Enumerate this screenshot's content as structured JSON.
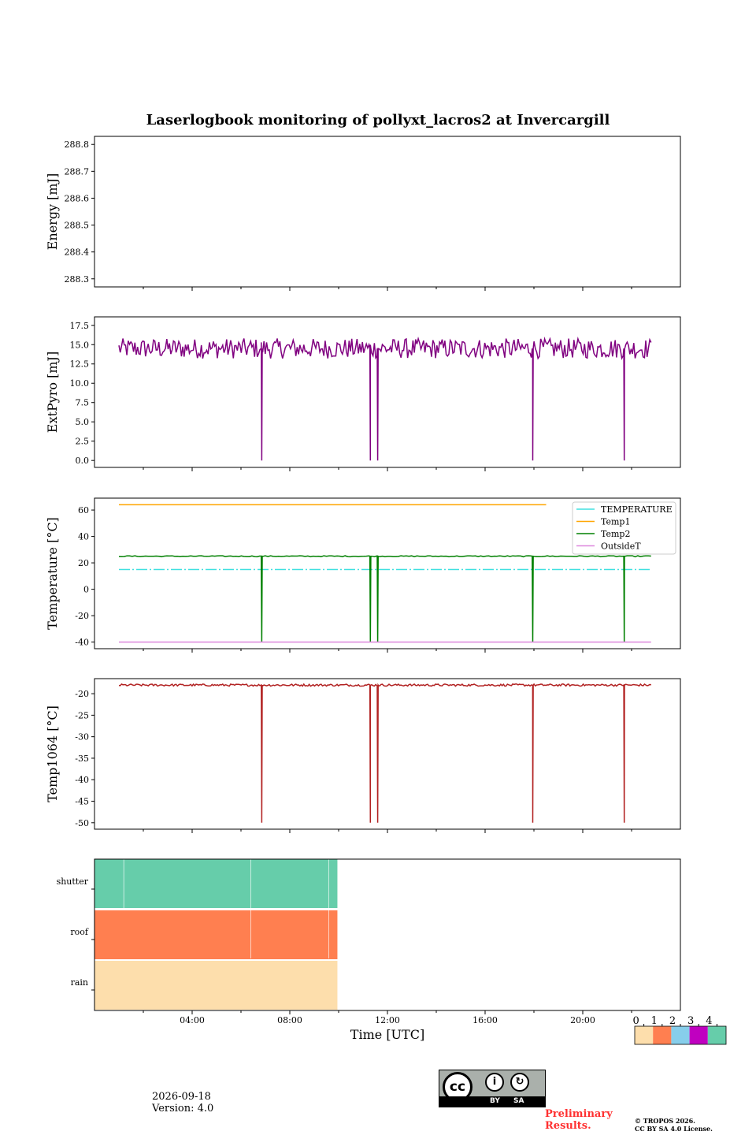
{
  "title": "Laserlogbook monitoring of pollyxt_lacros2 at Invercargill",
  "footer": {
    "date": "2026-09-18",
    "version": "Version: 4.0",
    "preliminary": "Preliminary Results.",
    "copyright_line1": "© TROPOS 2026.",
    "copyright_line2": "CC BY SA 4.0 License.",
    "license_by": "BY",
    "license_sa": "SA",
    "license_cc": "cc"
  },
  "colors": {
    "extpyro": "#800080",
    "temperature": "#40e0e0",
    "temp1": "#ffa500",
    "temp2": "#008000",
    "outside": "#dd88dd",
    "temp1064": "#b22222",
    "status0": "#fddeac",
    "status1": "#ff7f50",
    "status2": "#87ceeb",
    "status3": "#c000c0",
    "status4": "#66cdaa"
  },
  "chart_data": [
    {
      "type": "line",
      "panel": "energy",
      "ylabel": "Energy [mJ]",
      "yticks": [
        288.3,
        288.4,
        288.5,
        288.6,
        288.7,
        288.8
      ],
      "ylim": [
        288.27,
        288.83
      ],
      "xlim_hours": [
        0,
        24
      ],
      "series": []
    },
    {
      "type": "line",
      "panel": "extpyro",
      "ylabel": "ExtPyro [mJ]",
      "yticks": [
        0.0,
        2.5,
        5.0,
        7.5,
        10.0,
        12.5,
        15.0,
        17.5
      ],
      "ytick_labels": [
        "0.0",
        "2.5",
        "5.0",
        "7.5",
        "10.0",
        "12.5",
        "15.0",
        "17.5"
      ],
      "ylim": [
        -0.9,
        18.6
      ],
      "x_start_hour": 1.0,
      "x_end_hour": 22.8,
      "baseline": 14.5,
      "noise": 1.3,
      "drops_hours": [
        6.85,
        11.3,
        11.6,
        17.95,
        21.7
      ],
      "drop_value": 0.0
    },
    {
      "type": "line",
      "panel": "temperature",
      "ylabel": "Temperature [°C]",
      "yticks": [
        -40,
        -20,
        0,
        20,
        40,
        60
      ],
      "ylim": [
        -45,
        69
      ],
      "legend_position": "upper right",
      "series": [
        {
          "name": "TEMPERATURE",
          "level": 15,
          "x_start_hour": 1.0,
          "x_end_hour": 22.8,
          "style": "dashdot"
        },
        {
          "name": "Temp1",
          "level": 64,
          "x_start_hour": 1.0,
          "x_end_hour": 18.5,
          "style": "solid"
        },
        {
          "name": "Temp2",
          "level": 25,
          "x_start_hour": 1.0,
          "x_end_hour": 22.8,
          "style": "solid",
          "drops_hours": [
            6.85,
            11.3,
            11.6,
            17.95,
            21.7
          ],
          "drop_value": -40
        },
        {
          "name": "OutsideT",
          "level": -40,
          "x_start_hour": 1.0,
          "x_end_hour": 22.8,
          "style": "solid"
        }
      ]
    },
    {
      "type": "line",
      "panel": "temp1064",
      "ylabel": "Temp1064 [°C]",
      "yticks": [
        -50,
        -45,
        -40,
        -35,
        -30,
        -25,
        -20
      ],
      "ylim": [
        -51.5,
        -16.5
      ],
      "x_start_hour": 1.0,
      "x_end_hour": 22.8,
      "baseline": -18.0,
      "drops_hours": [
        6.85,
        11.3,
        11.6,
        17.95,
        21.7
      ],
      "drop_value": -50
    },
    {
      "type": "heatmap",
      "panel": "status",
      "rows": [
        "shutter",
        "roof",
        "rain"
      ],
      "row_values": [
        4,
        1,
        0
      ],
      "x_start_hour": 0,
      "x_end_hour": 9.95,
      "gap_lines_hours": {
        "shutter": [
          1.2,
          6.4,
          9.6
        ],
        "roof": [
          6.4,
          9.6
        ],
        "rain": []
      },
      "xticks_hours": [
        4,
        8,
        12,
        16,
        20
      ],
      "xtick_labels": [
        "04:00",
        "08:00",
        "12:00",
        "16:00",
        "20:00"
      ],
      "xlabel": "Time [UTC]",
      "xlim_hours": [
        0,
        24
      ]
    }
  ],
  "colorbar": {
    "labels": [
      "0",
      "1",
      "2",
      "3",
      "4"
    ]
  }
}
